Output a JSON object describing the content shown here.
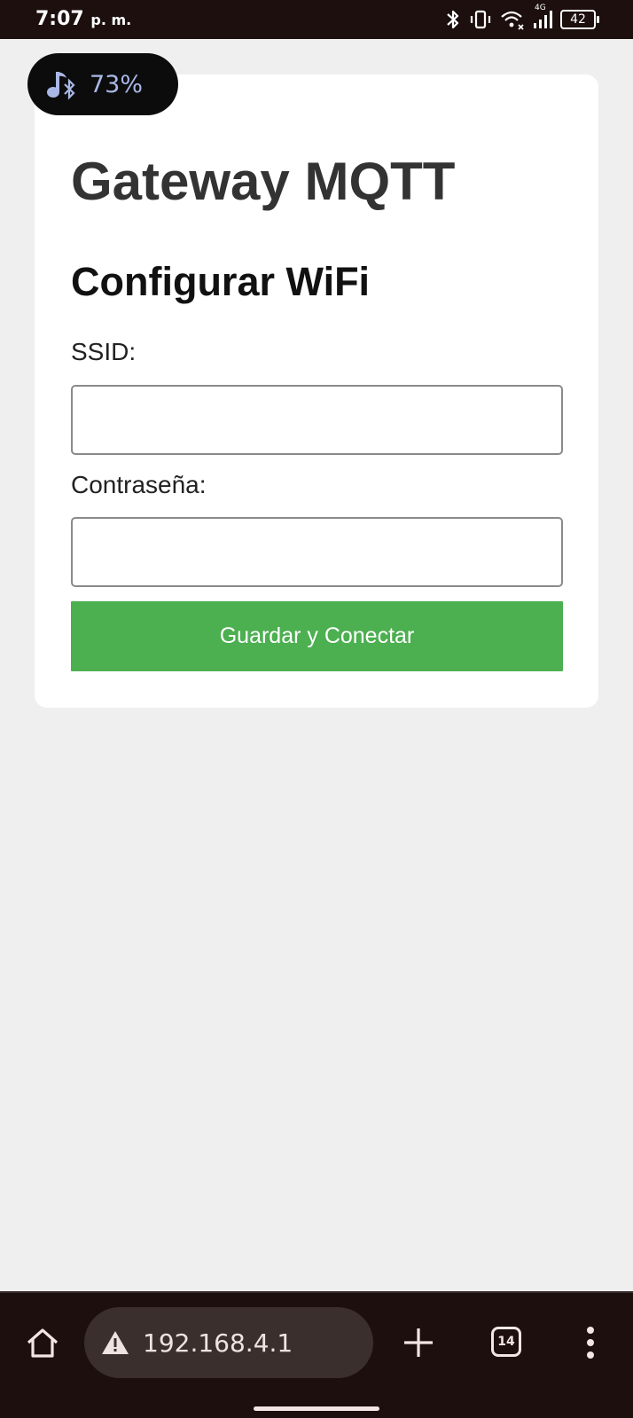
{
  "status_bar": {
    "time": "7:07",
    "ampm": "p. m.",
    "network_type": "4G",
    "battery_level": "42",
    "icons": [
      "bluetooth-icon",
      "vibrate-icon",
      "wifi-icon",
      "signal-icon",
      "battery-icon"
    ]
  },
  "media_pill": {
    "icon": "music-bluetooth-icon",
    "volume": "73%"
  },
  "page": {
    "title": "Gateway MQTT",
    "subtitle": "Configurar WiFi",
    "ssid_label": "SSID:",
    "ssid_value": "",
    "password_label": "Contraseña:",
    "password_value": "",
    "submit_label": "Guardar y Conectar",
    "accent_color": "#4caf50"
  },
  "browser": {
    "url": "192.168.4.1",
    "tab_count": "14",
    "icons": [
      "home-icon",
      "warning-icon",
      "plus-icon",
      "tabs-icon",
      "more-vert-icon"
    ]
  }
}
